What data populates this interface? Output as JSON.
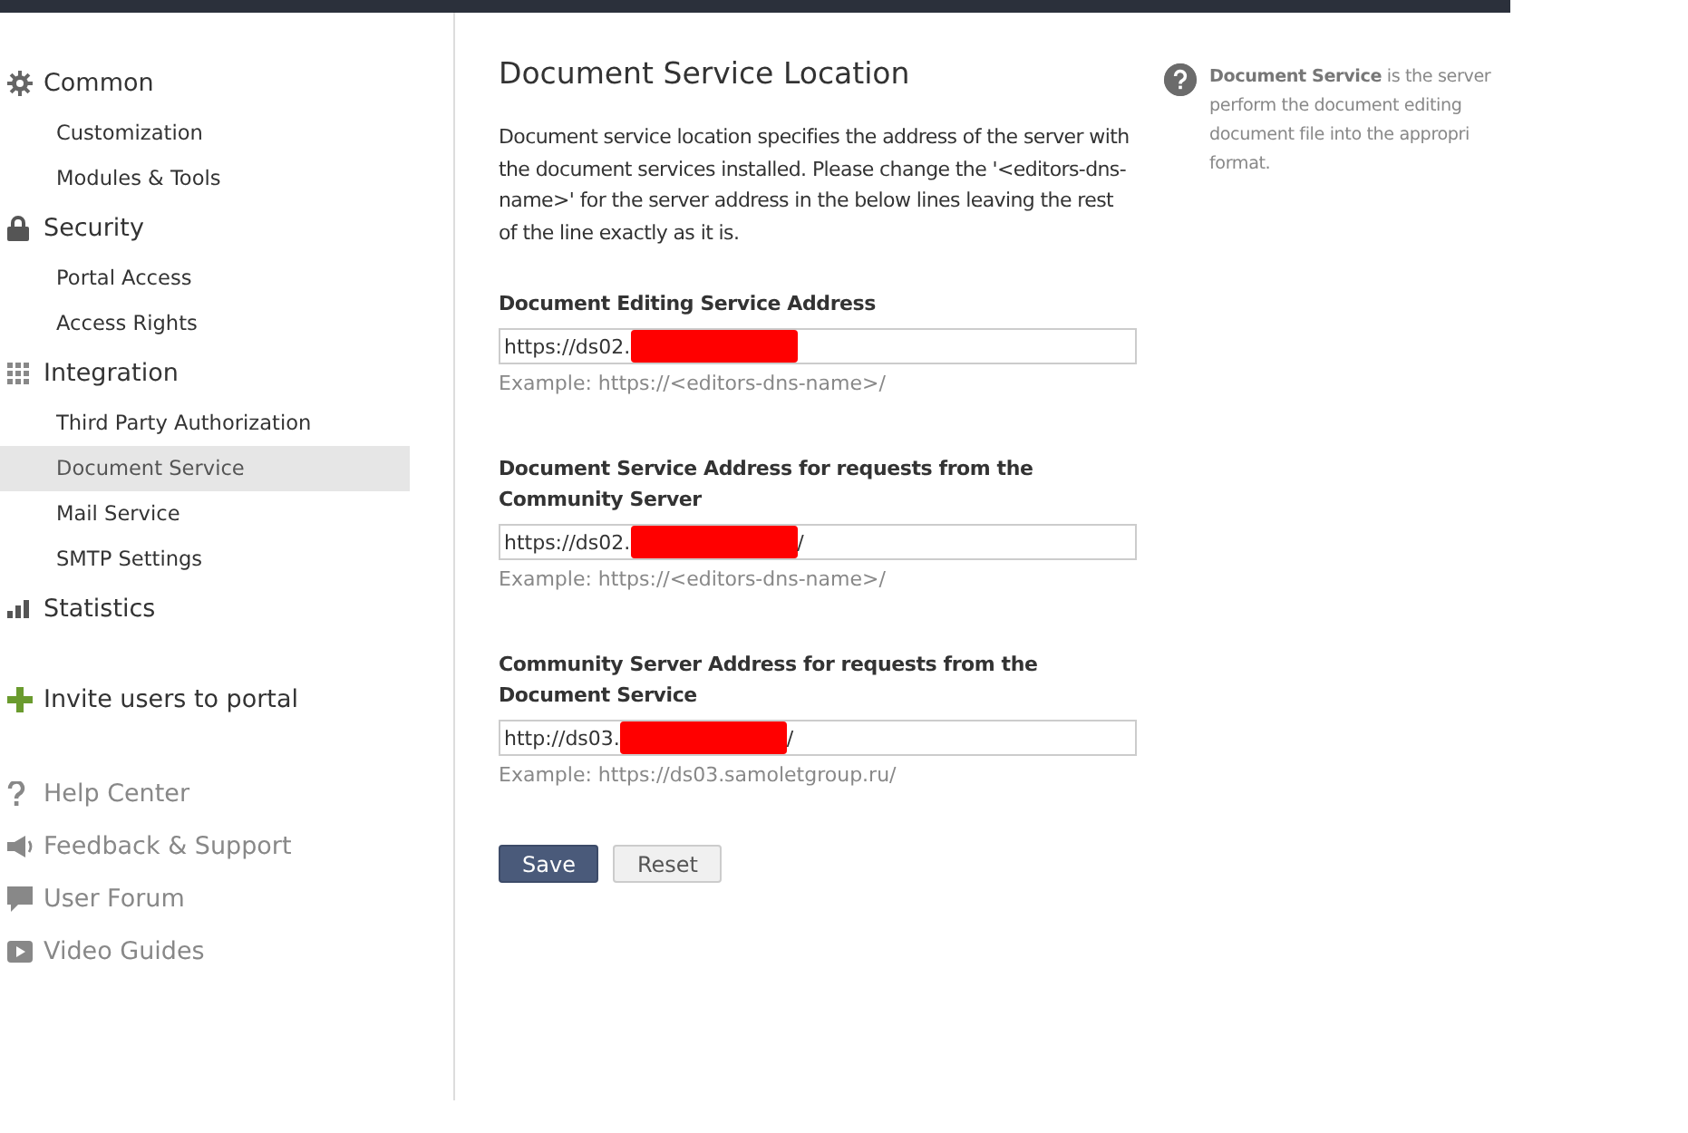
{
  "sidebar": {
    "sections": [
      {
        "kind": "gear",
        "label": "Common",
        "items": [
          {
            "label": "Customization",
            "selected": false
          },
          {
            "label": "Modules & Tools",
            "selected": false
          }
        ]
      },
      {
        "kind": "lock",
        "label": "Security",
        "items": [
          {
            "label": "Portal Access",
            "selected": false
          },
          {
            "label": "Access Rights",
            "selected": false
          }
        ]
      },
      {
        "kind": "grid",
        "label": "Integration",
        "items": [
          {
            "label": "Third Party Authorization",
            "selected": false
          },
          {
            "label": "Document Service",
            "selected": true
          },
          {
            "label": "Mail Service",
            "selected": false
          },
          {
            "label": "SMTP Settings",
            "selected": false
          }
        ]
      },
      {
        "kind": "bars",
        "label": "Statistics"
      }
    ],
    "invite": {
      "label": "Invite users to portal"
    },
    "help_links": [
      {
        "kind": "question",
        "label": "Help Center"
      },
      {
        "kind": "megaphone",
        "label": "Feedback & Support"
      },
      {
        "kind": "chat",
        "label": "User Forum"
      },
      {
        "kind": "video",
        "label": "Video Guides"
      }
    ]
  },
  "main": {
    "title": "Document Service Location",
    "description": "Document service location specifies the address of the server with the document services installed. Please change the '<editors-dns-name>' for the server address in the below lines leaving the rest of the line exactly as it is.",
    "fields": [
      {
        "label": "Document Editing Service Address",
        "value": "https://ds02.",
        "example": "Example: https://<editors-dns-name>/"
      },
      {
        "label": "Document Service Address for requests from the Community Server",
        "value": "https://ds02.",
        "after_redaction": "/",
        "example": "Example: https://<editors-dns-name>/"
      },
      {
        "label": "Community Server Address for requests from the Document Service",
        "value": "http://ds03.",
        "after_redaction": "/",
        "example": "Example: https://ds03.samoletgroup.ru/"
      }
    ],
    "buttons": [
      {
        "kind": "primary",
        "label": "Save"
      },
      {
        "kind": "secondary",
        "label": "Reset"
      }
    ]
  },
  "help_note": {
    "lines": [
      "**Document Service** is the server",
      "perform the document editing",
      "document file into the appropri",
      "format."
    ]
  }
}
